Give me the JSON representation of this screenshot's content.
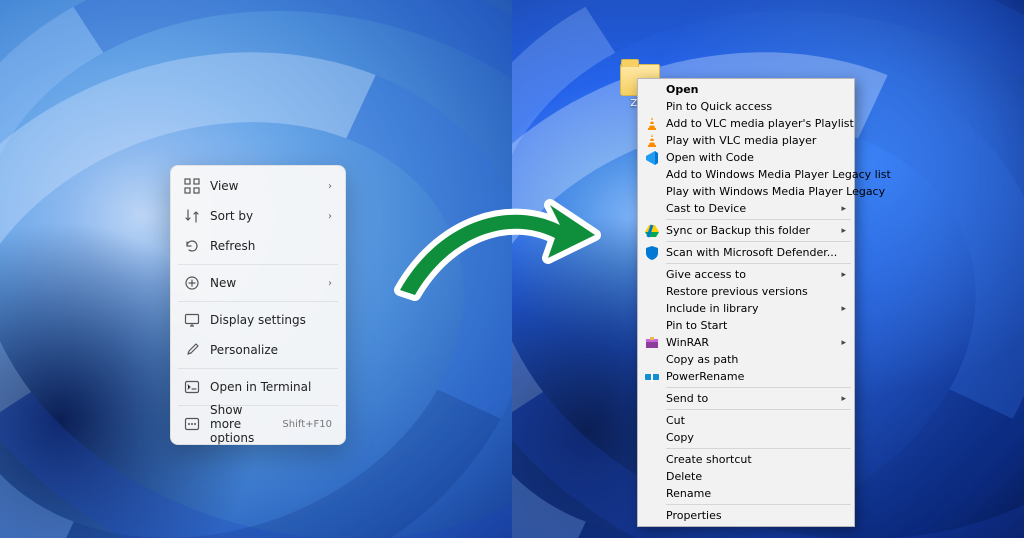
{
  "left_menu": {
    "view": "View",
    "sort_by": "Sort by",
    "refresh": "Refresh",
    "new": "New",
    "display_settings": "Display settings",
    "personalize": "Personalize",
    "open_in_terminal": "Open in Terminal",
    "show_more_options": "Show more options",
    "show_more_shortcut": "Shift+F10"
  },
  "right_menu": {
    "open": "Open",
    "pin_quick_access": "Pin to Quick access",
    "add_vlc_playlist": "Add to VLC media player's Playlist",
    "play_vlc": "Play with VLC media player",
    "open_with_code": "Open with Code",
    "add_wmp_legacy_list": "Add to Windows Media Player Legacy list",
    "play_wmp_legacy": "Play with Windows Media Player Legacy",
    "cast_device": "Cast to Device",
    "sync_backup": "Sync or Backup this folder",
    "scan_defender": "Scan with Microsoft Defender...",
    "give_access_to": "Give access to",
    "restore_previous": "Restore previous versions",
    "include_library": "Include in library",
    "pin_to_start": "Pin to Start",
    "winrar": "WinRAR",
    "copy_as_path": "Copy as path",
    "power_rename": "PowerRename",
    "send_to": "Send to",
    "cut": "Cut",
    "copy": "Copy",
    "create_shortcut": "Create shortcut",
    "delete": "Delete",
    "rename": "Rename",
    "properties": "Properties"
  },
  "desktop_folder_label": "Zen"
}
